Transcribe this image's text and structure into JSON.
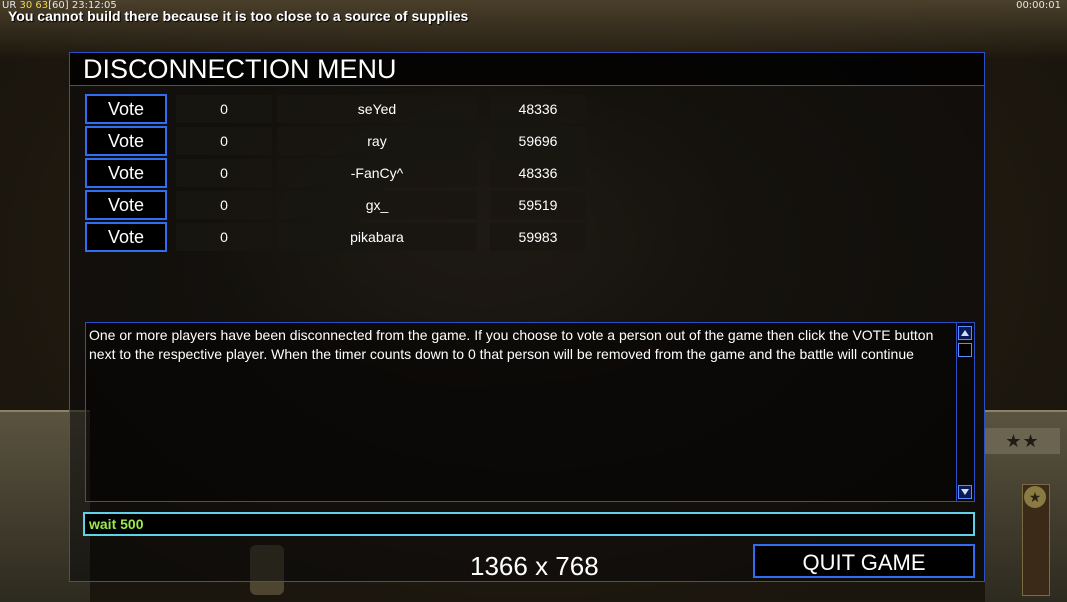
{
  "hud": {
    "stats_prefix": "UR",
    "stats_a": "30",
    "stats_b": "63",
    "stats_c": "[60]",
    "game_time": "23:12:05",
    "clock": "00:00:01",
    "message": "You cannot build there because it is too close to a source of supplies",
    "rank_stars": "★★"
  },
  "menu": {
    "title": "DISCONNECTION MENU",
    "players": [
      {
        "vote_label": "Vote",
        "votes": "0",
        "name": "seYed",
        "ping": "48336"
      },
      {
        "vote_label": "Vote",
        "votes": "0",
        "name": "ray",
        "ping": "59696"
      },
      {
        "vote_label": "Vote",
        "votes": "0",
        "name": "-FanCy^",
        "ping": "48336"
      },
      {
        "vote_label": "Vote",
        "votes": "0",
        "name": "gx_",
        "ping": "59519"
      },
      {
        "vote_label": "Vote",
        "votes": "0",
        "name": "pikabara",
        "ping": "59983"
      }
    ],
    "message": "One or more players have been disconnected from the game. If you choose to vote a person out of the game then click the VOTE button next to the respective player. When the timer counts down to 0 that person will be removed from the game and the battle will continue",
    "chat_value": "wait 500",
    "resolution": "1366 x 768",
    "quit_label": "QUIT GAME"
  },
  "colors": {
    "border": "#2c4fc8",
    "button_border": "#2f6ef2",
    "chat_border": "#5fd0e6",
    "chat_text": "#9bea4a"
  }
}
